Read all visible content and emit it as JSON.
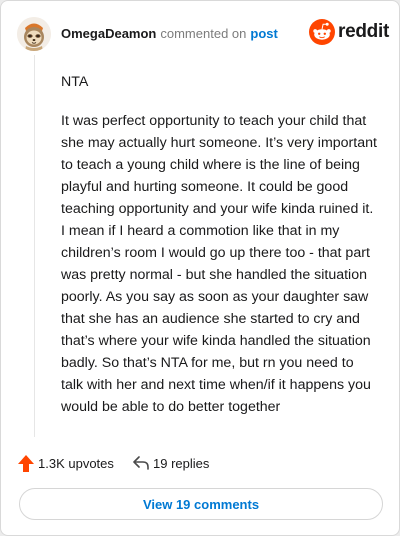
{
  "comment": {
    "username": "OmegaDeamon",
    "action_text": "commented on",
    "post_link_label": "post",
    "paragraphs": [
      "NTA",
      "It was perfect opportunity to teach your child that she may actually hurt someone. It’s very important to teach a young child where is the line of being playful and hurting someone. It could be good teaching opportunity and your wife kinda ruined it. I mean if I heard a commotion like that in my children’s room I would go up there too - that part was pretty normal - but she handled the situation poorly. As you say as soon as your daughter saw that she has an audience she started to cry and that’s where your wife kinda handled the situation badly. So that’s NTA for me, but rn you need to talk with her and next time when/if it happens you would be able to do better together"
    ]
  },
  "brand": {
    "wordmark": "reddit",
    "logo_icon": "reddit-snoo-icon",
    "color": "#ff4500"
  },
  "actions": {
    "upvotes_label": "1.3K upvotes",
    "upvote_icon": "upvote-arrow-icon",
    "upvote_color": "#ff4500",
    "replies_label": "19 replies",
    "reply_icon": "reply-arrow-icon"
  },
  "footer": {
    "view_comments_label": "View 19 comments",
    "link_color": "#0079d3"
  }
}
